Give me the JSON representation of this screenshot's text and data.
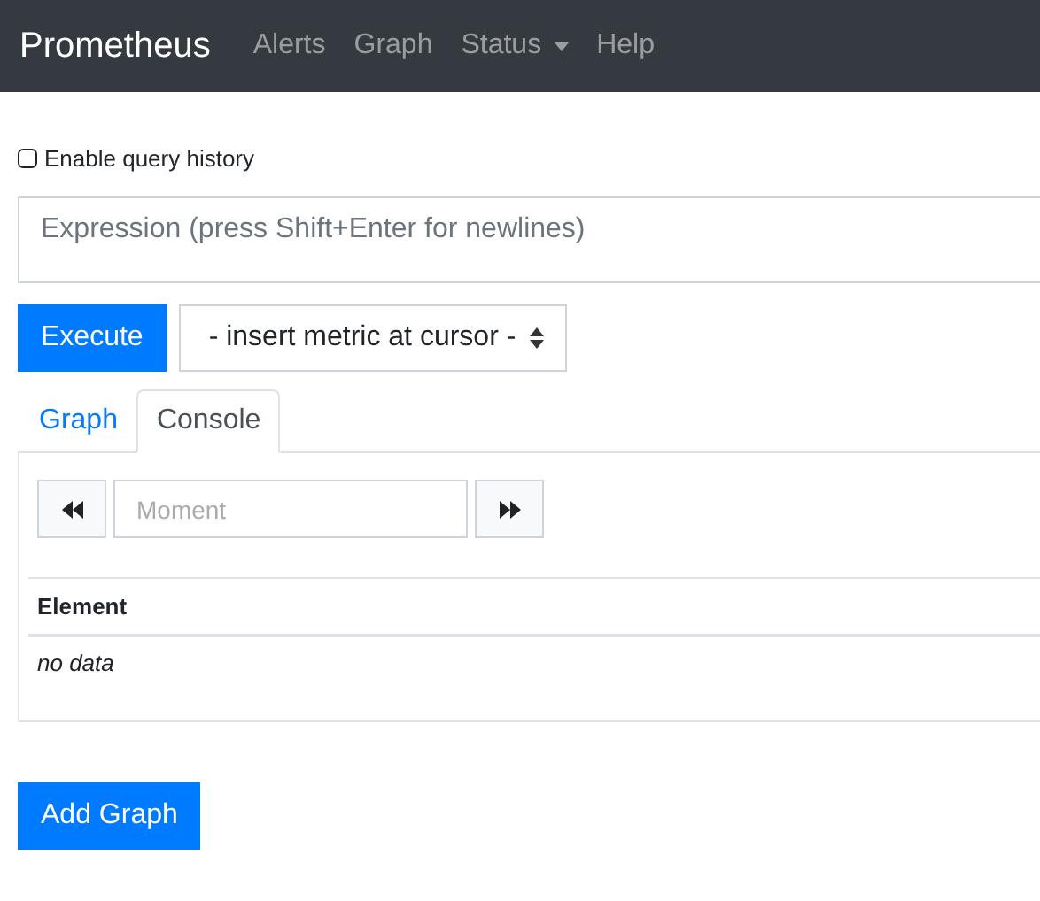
{
  "navbar": {
    "brand": "Prometheus",
    "links": [
      {
        "label": "Alerts",
        "kind": "link"
      },
      {
        "label": "Graph",
        "kind": "link"
      },
      {
        "label": "Status",
        "kind": "dropdown"
      },
      {
        "label": "Help",
        "kind": "link"
      }
    ]
  },
  "query_history": {
    "label": "Enable query history",
    "checked": false
  },
  "expression": {
    "placeholder": "Expression (press Shift+Enter for newlines)"
  },
  "execute_button": "Execute",
  "metric_select": {
    "value": "- insert metric at cursor -"
  },
  "tabs": [
    {
      "label": "Graph",
      "selected": false
    },
    {
      "label": "Console",
      "selected": true
    }
  ],
  "console": {
    "moment": {
      "placeholder": "Moment"
    },
    "table": {
      "columns": [
        "Element"
      ],
      "empty_text": "no data"
    }
  },
  "add_graph_button": "Add Graph"
}
